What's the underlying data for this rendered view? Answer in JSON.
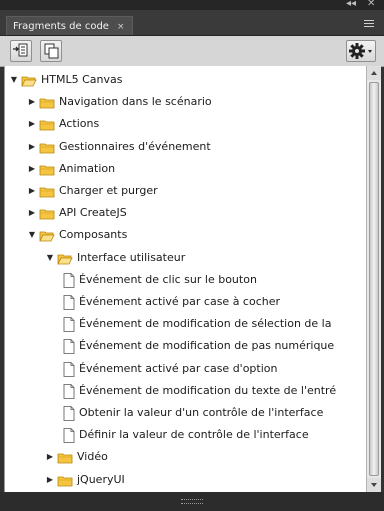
{
  "panel": {
    "tab_label": "Fragments de code",
    "tab_close": "×",
    "collapse_glyph": "◂◂",
    "close_glyph": "✕"
  },
  "toolbar": {
    "insert_icon": "insert-code-icon",
    "copy_icon": "copy-code-icon",
    "options_icon": "gear-icon"
  },
  "tree": [
    {
      "label": "HTML5 Canvas",
      "type": "folder",
      "state": "open",
      "depth": 0
    },
    {
      "label": "Navigation dans le scénario",
      "type": "folder",
      "state": "closed",
      "depth": 1
    },
    {
      "label": "Actions",
      "type": "folder",
      "state": "closed",
      "depth": 1
    },
    {
      "label": "Gestionnaires d'événement",
      "type": "folder",
      "state": "closed",
      "depth": 1
    },
    {
      "label": "Animation",
      "type": "folder",
      "state": "closed",
      "depth": 1
    },
    {
      "label": "Charger et purger",
      "type": "folder",
      "state": "closed",
      "depth": 1
    },
    {
      "label": "API CreateJS",
      "type": "folder",
      "state": "closed",
      "depth": 1
    },
    {
      "label": "Composants",
      "type": "folder",
      "state": "open",
      "depth": 1
    },
    {
      "label": "Interface utilisateur",
      "type": "folder",
      "state": "open",
      "depth": 2
    },
    {
      "label": "Événement de clic sur le bouton",
      "type": "file",
      "depth": 3
    },
    {
      "label": "Événement activé par case à cocher",
      "type": "file",
      "depth": 3
    },
    {
      "label": "Événement de modification de sélection de la",
      "type": "file",
      "depth": 3
    },
    {
      "label": "Événement de modification de pas numérique",
      "type": "file",
      "depth": 3
    },
    {
      "label": "Événement activé par case d'option",
      "type": "file",
      "depth": 3
    },
    {
      "label": "Événement de modification du texte de l'entré",
      "type": "file",
      "depth": 3
    },
    {
      "label": "Obtenir la valeur d'un contrôle de l'interface",
      "type": "file",
      "depth": 3
    },
    {
      "label": "Définir la valeur de contrôle de l'interface",
      "type": "file",
      "depth": 3
    },
    {
      "label": "Vidéo",
      "type": "folder",
      "state": "closed",
      "depth": 2
    },
    {
      "label": "jQueryUI",
      "type": "folder",
      "state": "closed",
      "depth": 2
    }
  ],
  "colors": {
    "folder_fill": "#f5c542",
    "folder_stroke": "#b8860b",
    "panel_bg": "#323232"
  }
}
